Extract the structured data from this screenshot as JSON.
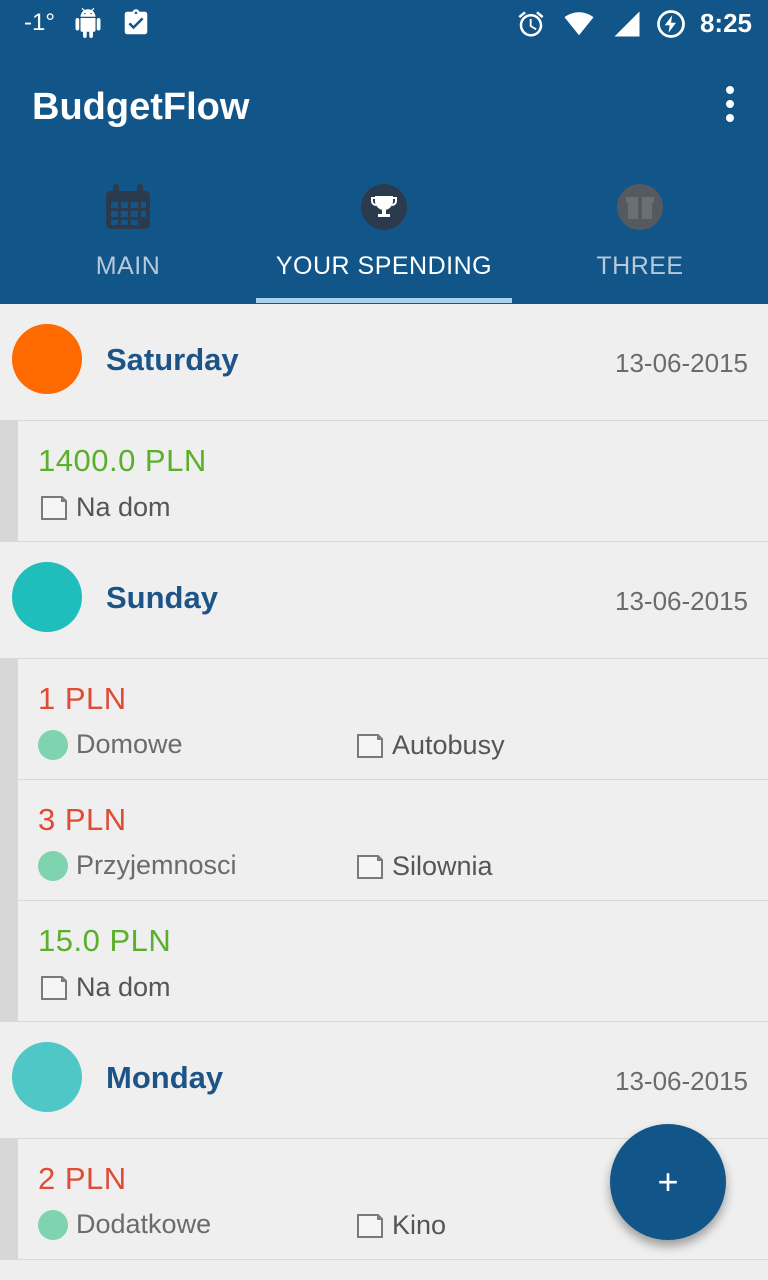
{
  "status_bar": {
    "temperature": "-1°",
    "time": "8:25"
  },
  "app": {
    "title": "BudgetFlow"
  },
  "tabs": [
    {
      "label": "MAIN",
      "icon": "calendar-icon",
      "active": false
    },
    {
      "label": "YOUR SPENDING",
      "icon": "trophy-icon",
      "active": true
    },
    {
      "label": "THREE",
      "icon": "gift-icon",
      "active": false
    }
  ],
  "days": [
    {
      "name": "Saturday",
      "date": "13-06-2015",
      "dot_color": "#ff6a00",
      "entries": [
        {
          "amount": "1400.0  PLN",
          "type": "income",
          "category": "",
          "note": "Na dom"
        }
      ]
    },
    {
      "name": "Sunday",
      "date": "13-06-2015",
      "dot_color": "#1fbdbb",
      "entries": [
        {
          "amount": "1  PLN",
          "type": "expense",
          "category": "Domowe",
          "note": "Autobusy"
        },
        {
          "amount": "3  PLN",
          "type": "expense",
          "category": "Przyjemnosci",
          "note": "Silownia"
        },
        {
          "amount": "15.0  PLN",
          "type": "income",
          "category": "",
          "note": "Na dom"
        }
      ]
    },
    {
      "name": "Monday",
      "date": "13-06-2015",
      "dot_color": "#4ec7c6",
      "entries": [
        {
          "amount": "2  PLN",
          "type": "expense",
          "category": "Dodatkowe",
          "note": "Kino"
        }
      ]
    }
  ],
  "fab": {
    "label": "+"
  },
  "colors": {
    "primary": "#115589",
    "income": "#5aaf2b",
    "expense": "#e04b36",
    "category_dot": "#7fd3ae"
  }
}
